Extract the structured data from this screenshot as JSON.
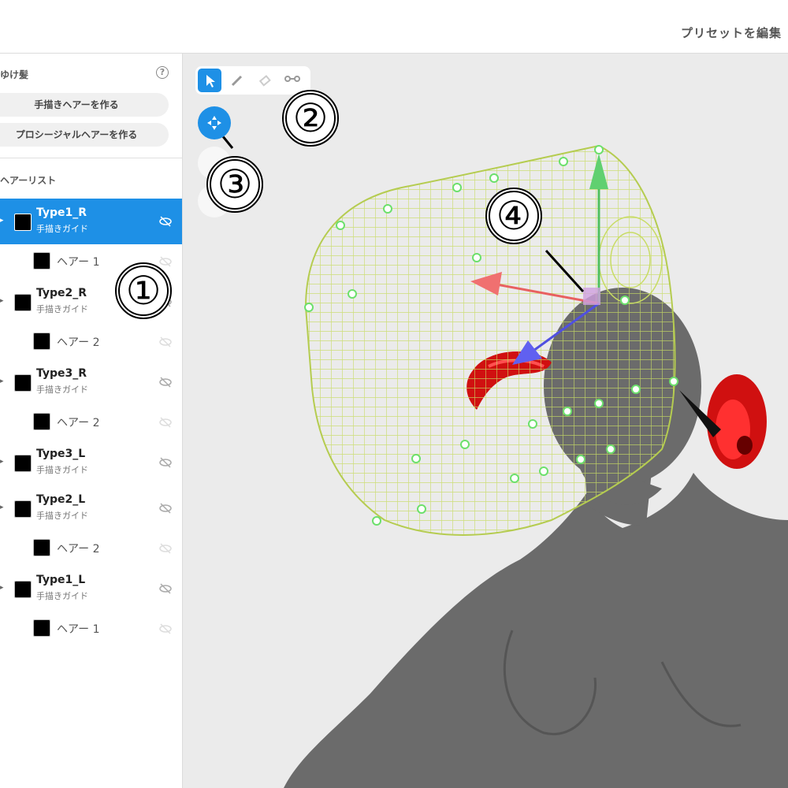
{
  "header": {
    "edit_preset": "プリセットを編集"
  },
  "sidebar": {
    "section_title": "ゆけ髪",
    "help_icon": "question-circle-icon",
    "help_glyph": "?",
    "hand_drawn_button": "手描きヘアーを作る",
    "procedural_button": "プロシージャルヘアーを作る",
    "list_title": "ヘアーリスト",
    "items": [
      {
        "name": "Type1_R",
        "sub": "手描きガイド",
        "selected": true,
        "children": [
          {
            "name": "ヘアー 1"
          }
        ]
      },
      {
        "name": "Type2_R",
        "sub": "手描きガイド",
        "children": [
          {
            "name": "ヘアー 2"
          }
        ]
      },
      {
        "name": "Type3_R",
        "sub": "手描きガイド",
        "children": [
          {
            "name": "ヘアー 2"
          }
        ]
      },
      {
        "name": "Type3_L",
        "sub": "手描きガイド",
        "children": []
      },
      {
        "name": "Type2_L",
        "sub": "手描きガイド",
        "children": [
          {
            "name": "ヘアー 2"
          }
        ]
      },
      {
        "name": "Type1_L",
        "sub": "手描きガイド",
        "children": [
          {
            "name": "ヘアー 1"
          }
        ]
      }
    ]
  },
  "toolbar": {
    "tools": [
      "select-arrow-icon",
      "pencil-icon",
      "eraser-icon",
      "nodes-icon"
    ],
    "active_tool": "select-arrow-icon",
    "move_button_icon": "move-arrows-icon"
  },
  "callouts": [
    "①",
    "②",
    "③",
    "④"
  ],
  "colors": {
    "accent": "#1e90e6",
    "cage": "#c8dc64",
    "control_point": "#6ce06c",
    "hair": "#d01010",
    "body": "#6b6b6b",
    "axis_x": "#e86060",
    "axis_y": "#50c060",
    "axis_z": "#5050e0"
  }
}
